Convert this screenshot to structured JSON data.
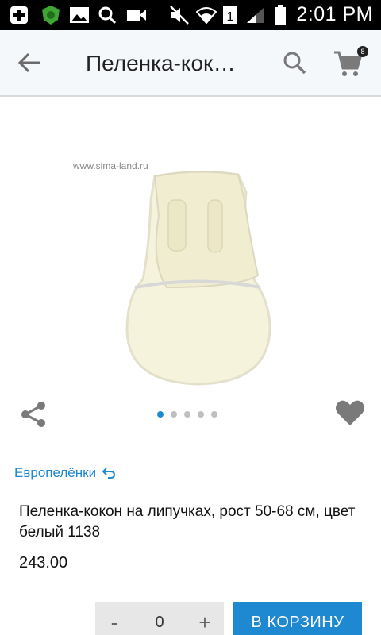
{
  "status_bar": {
    "time": "2:01 PM",
    "sim_badge": "1",
    "icons": [
      "plus-box-icon",
      "shield-app-icon",
      "gallery-icon",
      "search-icon",
      "video-icon",
      "mute-icon",
      "wifi-icon",
      "sim-icon",
      "signal-icon",
      "battery-icon"
    ]
  },
  "appbar": {
    "title": "Пеленка-кокон на липучках",
    "cart_count": "8",
    "icons": [
      "arrow-back-icon",
      "search-icon",
      "cart-icon"
    ]
  },
  "gallery": {
    "watermark": "www.sima-land.ru",
    "dots": [
      true,
      false,
      false,
      false,
      false
    ],
    "icons": [
      "share-icon",
      "heart-icon"
    ]
  },
  "product": {
    "brand": "Европелёнки",
    "name": "Пеленка-кокон на липучках, рост 50-68 см, цвет белый 1138",
    "price": "243.00"
  },
  "quantity": {
    "minus": "-",
    "value": "0",
    "plus": "+"
  },
  "actions": {
    "add_to_cart": "В КОРЗИНУ"
  },
  "colors": {
    "accent": "#1e88d0",
    "appbar_bg": "#f5f8fb",
    "status_bg": "#000000"
  }
}
